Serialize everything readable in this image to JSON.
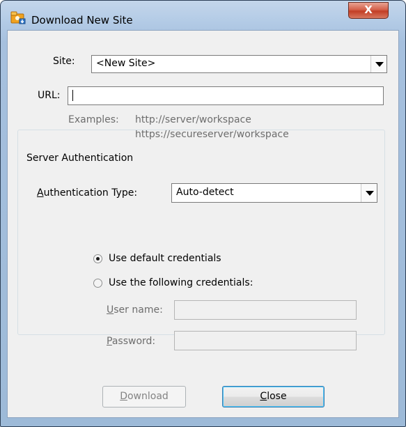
{
  "window": {
    "title": "Download New Site",
    "close_glyph": "X",
    "icon": "folder-app-icon"
  },
  "form": {
    "site_label": "Site:",
    "site_value": "<New Site>",
    "url_label": "URL:",
    "url_value": "",
    "examples_label": "Examples:",
    "example_1": "http://server/workspace",
    "example_2": "https://secureserver/workspace"
  },
  "auth": {
    "group_title": "Server Authentication",
    "type_label_mnemonic": "A",
    "type_label_rest": "uthentication Type:",
    "type_value": "Auto-detect",
    "radio_default_label": "Use default credentials",
    "radio_default_checked": true,
    "radio_following_label": "Use the following credentials:",
    "radio_following_checked": false,
    "username_mnemonic": "U",
    "username_rest": "ser name:",
    "username_value": "",
    "password_mnemonic": "P",
    "password_rest": "assword:",
    "password_value": ""
  },
  "buttons": {
    "download_mnemonic": "D",
    "download_rest": "ownload",
    "download_enabled": false,
    "close_mnemonic": "C",
    "close_rest": "lose"
  },
  "colors": {
    "titlebar": "#b3cbe6",
    "close_button": "#c23e25",
    "dialog_face": "#f0f0f0",
    "muted_text": "#6d6d6d"
  }
}
